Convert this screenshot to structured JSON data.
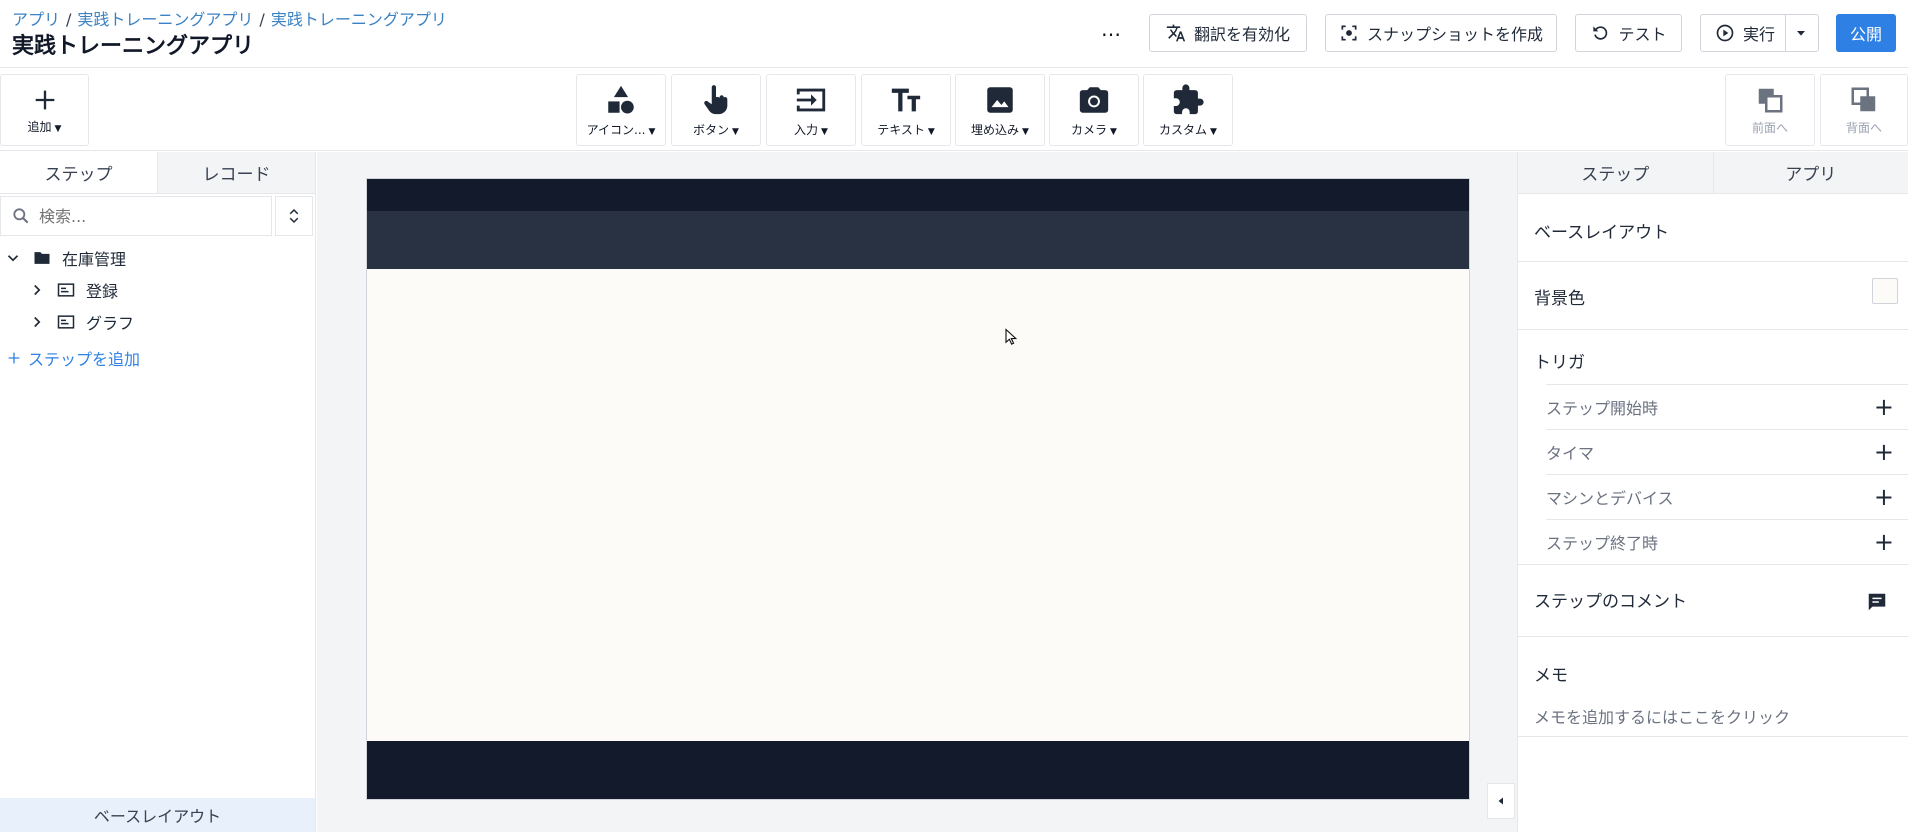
{
  "header": {
    "breadcrumb": [
      "アプリ",
      "実践トレーニングアプリ",
      "実践トレーニングアプリ"
    ],
    "breadcrumb_sep": "/",
    "title": "実践トレーニングアプリ",
    "more_label": "…",
    "translate_label": "翻訳を有効化",
    "snapshot_label": "スナップショットを作成",
    "test_label": "テスト",
    "run_label": "実行",
    "publish_label": "公開"
  },
  "toolbar": {
    "add_label": "追加",
    "tools": [
      {
        "label": "アイコン...",
        "icon": "shapes-icon"
      },
      {
        "label": "ボタン",
        "icon": "pointer-hand-icon"
      },
      {
        "label": "入力",
        "icon": "input-icon"
      },
      {
        "label": "テキスト",
        "icon": "text-icon"
      },
      {
        "label": "埋め込み",
        "icon": "image-icon"
      },
      {
        "label": "カメラ",
        "icon": "camera-icon"
      },
      {
        "label": "カスタム",
        "icon": "puzzle-icon"
      }
    ],
    "bring_front_label": "前面へ",
    "send_back_label": "背面へ"
  },
  "left_panel": {
    "tabs": [
      "ステップ",
      "レコード"
    ],
    "search_placeholder": "検索...",
    "tree": {
      "folder": "在庫管理",
      "items": [
        "登録",
        "グラフ"
      ]
    },
    "add_step_label": "ステップを追加",
    "footer_label": "ベースレイアウト"
  },
  "right_panel": {
    "tabs": [
      "ステップ",
      "アプリ"
    ],
    "base_layout": "ベースレイアウト",
    "background_color_label": "背景色",
    "background_color": "#fcfbf7",
    "triggers_title": "トリガ",
    "triggers": [
      "ステップ開始時",
      "タイマ",
      "マシンとデバイス",
      "ステップ終了時"
    ],
    "comment_title": "ステップのコメント",
    "memo_title": "メモ",
    "memo_placeholder": "メモを追加するにはここをクリック"
  },
  "colors": {
    "accent": "#2f80e4",
    "canvas_dark": "#131a2b",
    "canvas_sub": "#283243",
    "canvas_bg": "#fcfbf7"
  }
}
